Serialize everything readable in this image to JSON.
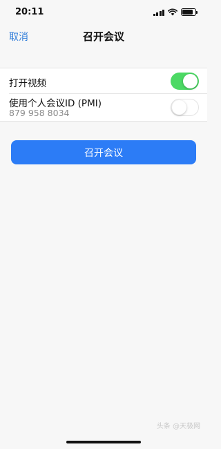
{
  "status_bar": {
    "time": "20:11",
    "icons": [
      "signal-icon",
      "wifi-icon",
      "battery-icon"
    ],
    "battery_level": 0.85
  },
  "nav": {
    "cancel_label": "取消",
    "title": "召开会议"
  },
  "settings": {
    "video": {
      "label": "打开视频",
      "enabled": true
    },
    "pmi": {
      "label": "使用个人会议ID (PMI)",
      "value": "879 958 8034",
      "enabled": false
    }
  },
  "actions": {
    "start_label": "召开会议"
  },
  "watermark": "头条 @天极网",
  "colors": {
    "accent": "#2c7cf6",
    "link": "#2d7bd9",
    "toggle_on": "#4cd964",
    "background": "#f7f7f7"
  }
}
